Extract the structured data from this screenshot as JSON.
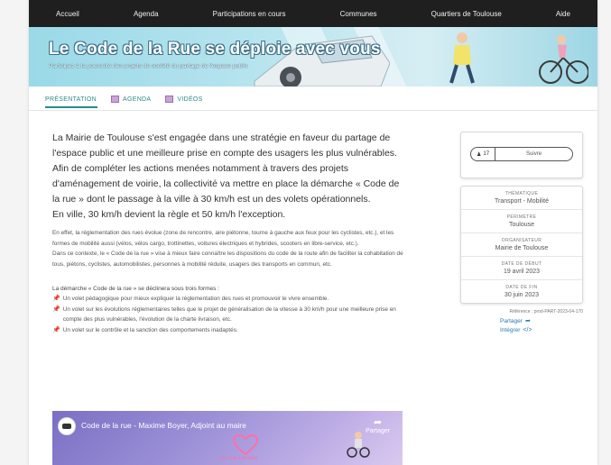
{
  "nav": {
    "items": [
      "Accueil",
      "Agenda",
      "Participations en cours",
      "Communes",
      "Quartiers de Toulouse",
      "Aide"
    ]
  },
  "banner": {
    "title": "Le Code de la Rue se déploie avec vous",
    "subtitle": "Participez à la poursuite des projets de société du partage de l'espace public"
  },
  "tabs": [
    {
      "label": "PRÉSENTATION",
      "active": true
    },
    {
      "label": "AGENDA",
      "active": false
    },
    {
      "label": "VIDÉOS",
      "active": false
    }
  ],
  "main": {
    "lead": "La Mairie de Toulouse s'est engagée dans une stratégie en faveur du partage de l'espace public et une meilleure prise en compte des usagers les plus vulnérables. Afin de compléter les actions menées notamment à travers des projets d'aménagement de voirie, la collectivité va mettre en place la démarche « Code de la rue » dont le passage à la ville à 30 km/h est un des volets opérationnels.",
    "lead_last": "En ville, 30 km/h devient la règle et 50 km/h l'exception.",
    "para1": "En effet, la réglementation des rues évolue (zone de rencontre, aire piétonne, tourne à gauche aux feux pour les cyclistes, etc.), et les formes de mobilité aussi (vélos, vélos cargo, trottinettes, voitures électriques et hybrides, scooters en libre-service, etc.).",
    "para2": "Dans ce contexte, le « Code de la rue » vise à mieux faire connaître les dispositions du code de la route afin de faciliter la cohabitation de tous, piétons, cyclistes, automobilistes, personnes à mobilité réduite, usagers des transports en commun, etc.",
    "demarche_title": "La démarche « Code de la rue » se déclinera sous trois formes :",
    "bullets": [
      "Un volet pédagogique pour mieux expliquer la réglementation des rues et promouvoir le vivre ensemble.",
      "Un volet sur les évolutions réglementaires telles que le projet de généralisation de la vitesse à 30 km/h pour une meilleure prise en compte des plus vulnérables, l'évolution de la charte livraison, etc.",
      "Un volet sur le contrôle et la sanction des comportements inadaptés."
    ]
  },
  "video": {
    "title": "Code de la rue - Maxime Boyer, Adjoint au maire",
    "share_label": "Partager",
    "caption": "Dis Vélo à Mobilité"
  },
  "sidebar": {
    "follow_count": "17",
    "follow_label": "Suivre",
    "info": [
      {
        "label": "THÉMATIQUE",
        "value": "Transport - Mobilité"
      },
      {
        "label": "PÉRIMÈTRE",
        "value": "Toulouse"
      },
      {
        "label": "ORGANISATEUR",
        "value": "Mairie de Toulouse"
      },
      {
        "label": "DATE DE DÉBUT",
        "value": "19 avril 2023"
      },
      {
        "label": "DATE DE FIN",
        "value": "30 juin 2023"
      }
    ],
    "reference": "Référence : prod-PART-2023-04-170",
    "share_label": "Partager",
    "embed_label": "Intégrer"
  },
  "colors": {
    "nav_bg": "#1f1f1f",
    "accent": "#2a8a8a",
    "link": "#2a7ab0",
    "pin": "#c0392b"
  }
}
